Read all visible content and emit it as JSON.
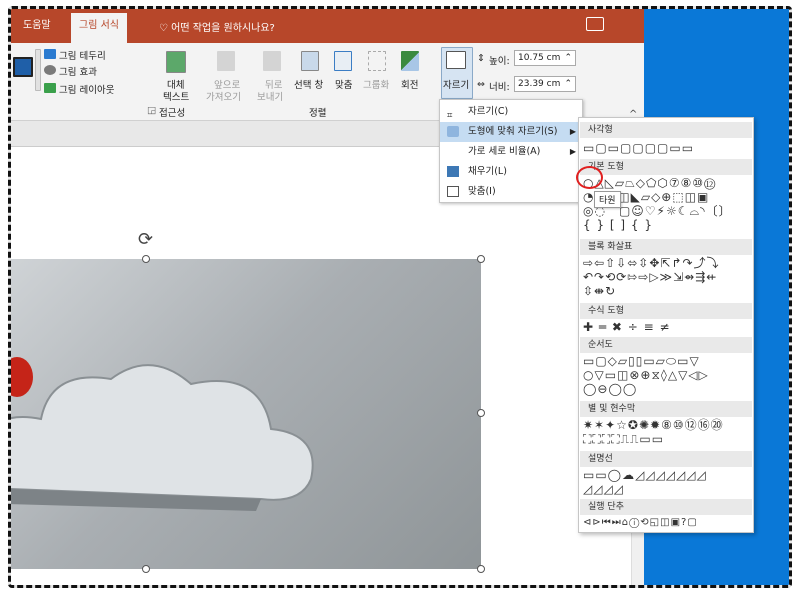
{
  "titlebar": {
    "tab_help": "도움말",
    "tab_picture_format": "그림 서식",
    "tell_me": "어떤 작업을 원하시나요?"
  },
  "ribbon": {
    "picture_border": "그림 테두리",
    "picture_effects": "그림 효과",
    "picture_layout": "그림 레이아웃",
    "alt_text_1": "대체",
    "alt_text_2": "텍스트",
    "group_accessibility": "접근성",
    "bring_forward_1": "앞으로",
    "bring_forward_2": "가져오기",
    "send_backward_1": "뒤로",
    "send_backward_2": "보내기",
    "selection_pane": "선택 창",
    "align": "맞춤",
    "group": "그룹화",
    "rotate": "회전",
    "group_arrange": "정렬",
    "crop": "자르기",
    "height_label": "높이:",
    "height_value": "10.75 cm",
    "width_label": "너비:",
    "width_value": "23.39 cm"
  },
  "crop_menu": {
    "items": [
      {
        "label": "자르기(C)"
      },
      {
        "label": "도형에 맞춰 자르기(S)"
      },
      {
        "label": "가로 세로 비율(A)"
      },
      {
        "label": "채우기(L)"
      },
      {
        "label": "맞춤(I)"
      }
    ]
  },
  "shape_gallery": {
    "rectangles": "사각형",
    "basic_shapes": "기본 도형",
    "block_arrows": "블록 화살표",
    "equation_shapes": "수식 도형",
    "flowchart": "순서도",
    "stars_banners": "별 및 현수막",
    "callouts": "설명선",
    "action_buttons": "실행 단추",
    "tooltip": "타원"
  },
  "colors": {
    "accent": "#b7472a",
    "desktop": "#0a78d7",
    "highlight": "#c5dcf2",
    "marker": "#e02020"
  }
}
